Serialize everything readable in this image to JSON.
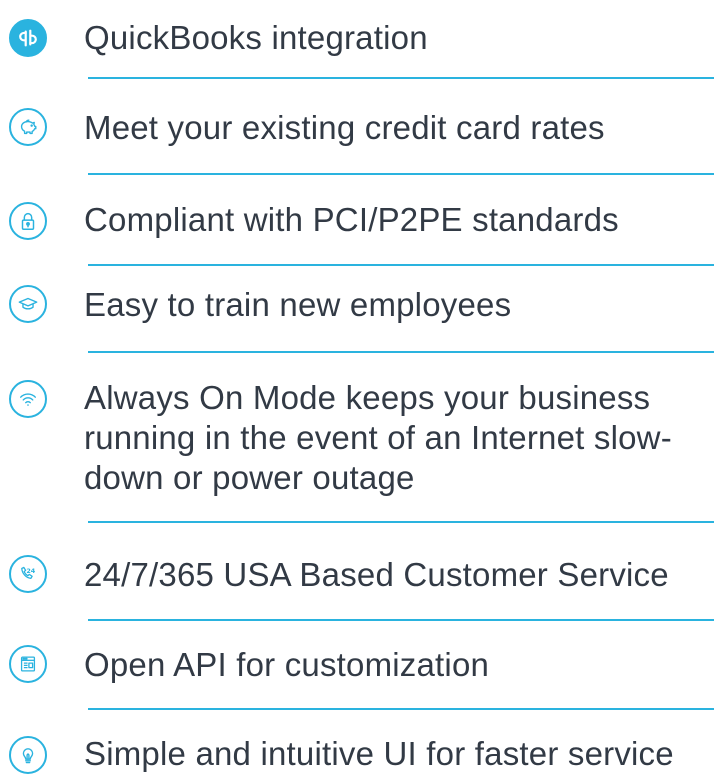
{
  "colors": {
    "accent": "#2ab3df",
    "text": "#323a45",
    "background": "#ffffff"
  },
  "features": [
    {
      "icon": "quickbooks-icon",
      "label": "QuickBooks integration"
    },
    {
      "icon": "piggy-bank-icon",
      "label": "Meet your existing credit card rates"
    },
    {
      "icon": "lock-icon",
      "label": "Compliant with PCI/P2PE standards"
    },
    {
      "icon": "graduation-cap-icon",
      "label": "Easy to train new employees"
    },
    {
      "icon": "wifi-icon",
      "label": "Always On Mode keeps your business running in the event of an Internet slow-down or power outage"
    },
    {
      "icon": "phone-24-icon",
      "label": "24/7/365 USA Based Customer Service"
    },
    {
      "icon": "browser-window-icon",
      "label": "Open API for customization"
    },
    {
      "icon": "lightbulb-icon",
      "label": "Simple and intuitive UI for faster service"
    }
  ]
}
